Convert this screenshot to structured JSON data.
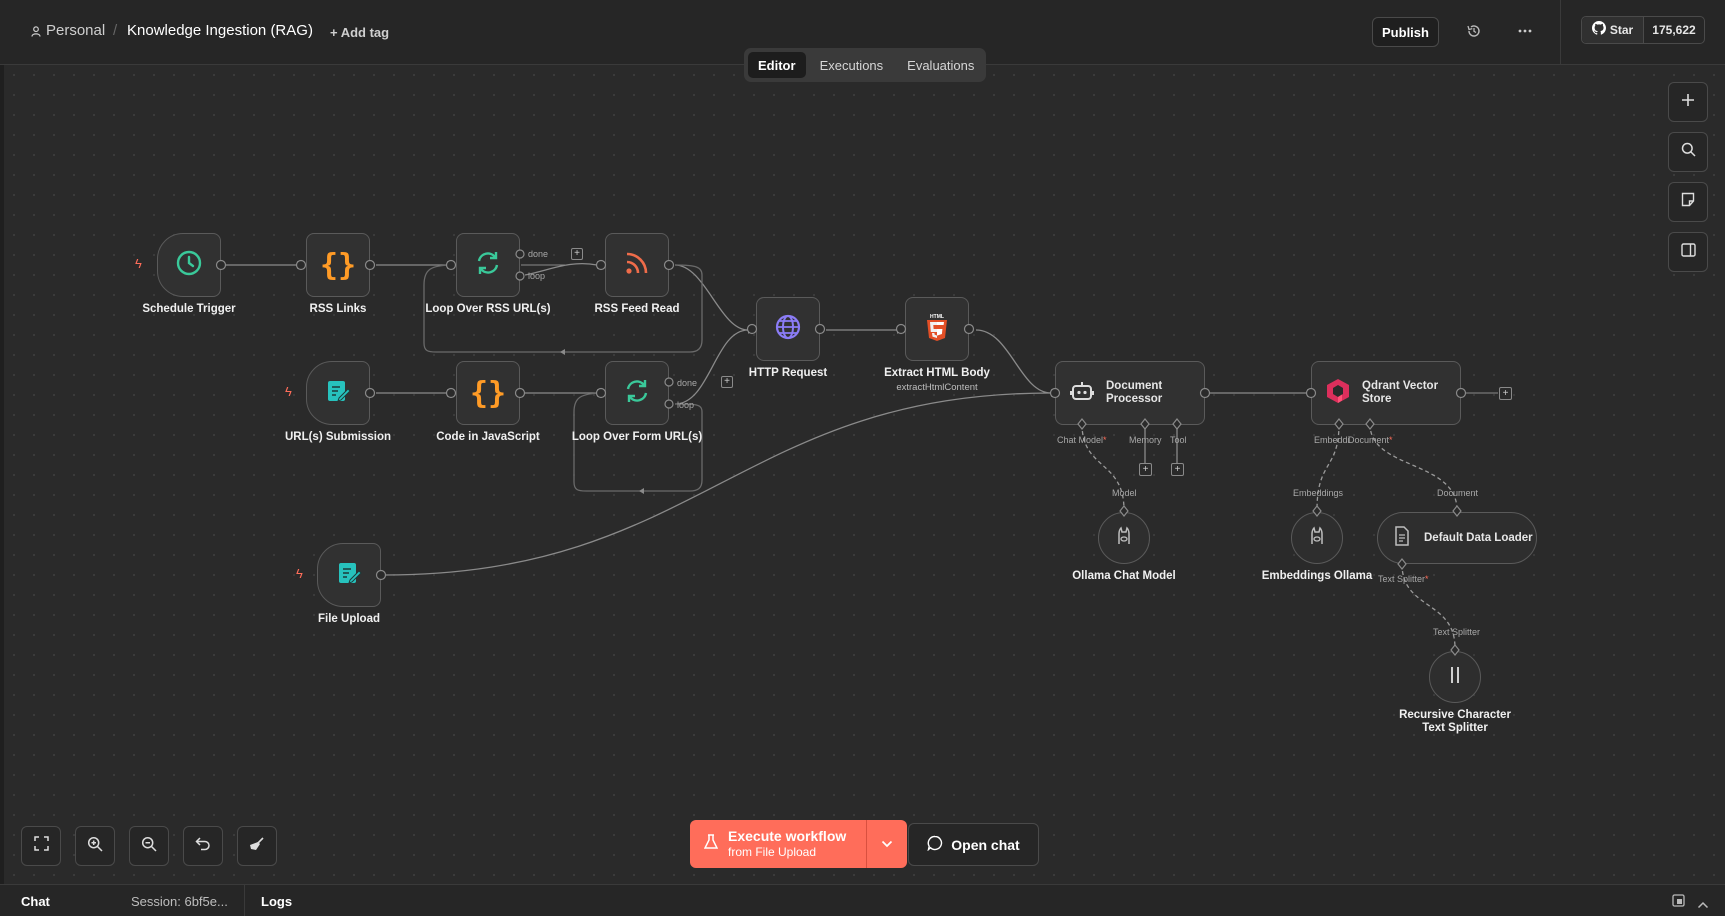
{
  "header": {
    "workspace": "Personal",
    "separator": "/",
    "workflow_name": "Knowledge Ingestion (RAG)",
    "add_tag": "+ Add tag",
    "publish": "Publish",
    "star_label": "Star",
    "star_count": "175,622"
  },
  "tabs": [
    {
      "label": "Editor",
      "active": true
    },
    {
      "label": "Executions",
      "active": false
    },
    {
      "label": "Evaluations",
      "active": false
    }
  ],
  "nodes": {
    "schedule_trigger": "Schedule Trigger",
    "rss_links": "RSS Links",
    "loop_rss": "Loop Over RSS URL(s)",
    "rss_feed_read": "RSS Feed Read",
    "url_submission": "URL(s) Submission",
    "code_js": "Code in JavaScript",
    "loop_form": "Loop Over Form URL(s)",
    "http_request": "HTTP Request",
    "extract_html": "Extract HTML Body",
    "extract_html_sub": "extractHtmlContent",
    "document_processor": "Document\nProcessor",
    "qdrant": "Qdrant Vector\nStore",
    "file_upload": "File Upload",
    "ollama_chat": "Ollama Chat Model",
    "embeddings_ollama": "Embeddings Ollama",
    "default_loader": "Default Data Loader",
    "text_splitter": "Recursive Character\nText Splitter"
  },
  "ports": {
    "done": "done",
    "loop": "loop",
    "chat_model": "Chat Model",
    "memory": "Memory",
    "tool": "Tool",
    "model": "Model",
    "embedding": "Embeddi",
    "document": "Document",
    "embeddings": "Embeddings",
    "document2": "Document",
    "text_splitter": "Text Splitter",
    "text_splitter2": "Text Splitter",
    "required": "*"
  },
  "execute": {
    "label": "Execute workflow",
    "sub": "from File Upload"
  },
  "open_chat": "Open chat",
  "bottom": {
    "chat": "Chat",
    "session": "Session: 6bf5e...",
    "logs": "Logs"
  },
  "colors": {
    "accent": "#ff6d5a",
    "trigger_bolt": "#ff6d5a",
    "schedule": "#3ac99a",
    "code": "#ff9b26",
    "loop": "#3ac99a",
    "rss": "#ef6c4a",
    "form": "#27c2bd",
    "http": "#8b7cf6",
    "html5": "#e34f26",
    "qdrant": "#dc2f5c"
  }
}
